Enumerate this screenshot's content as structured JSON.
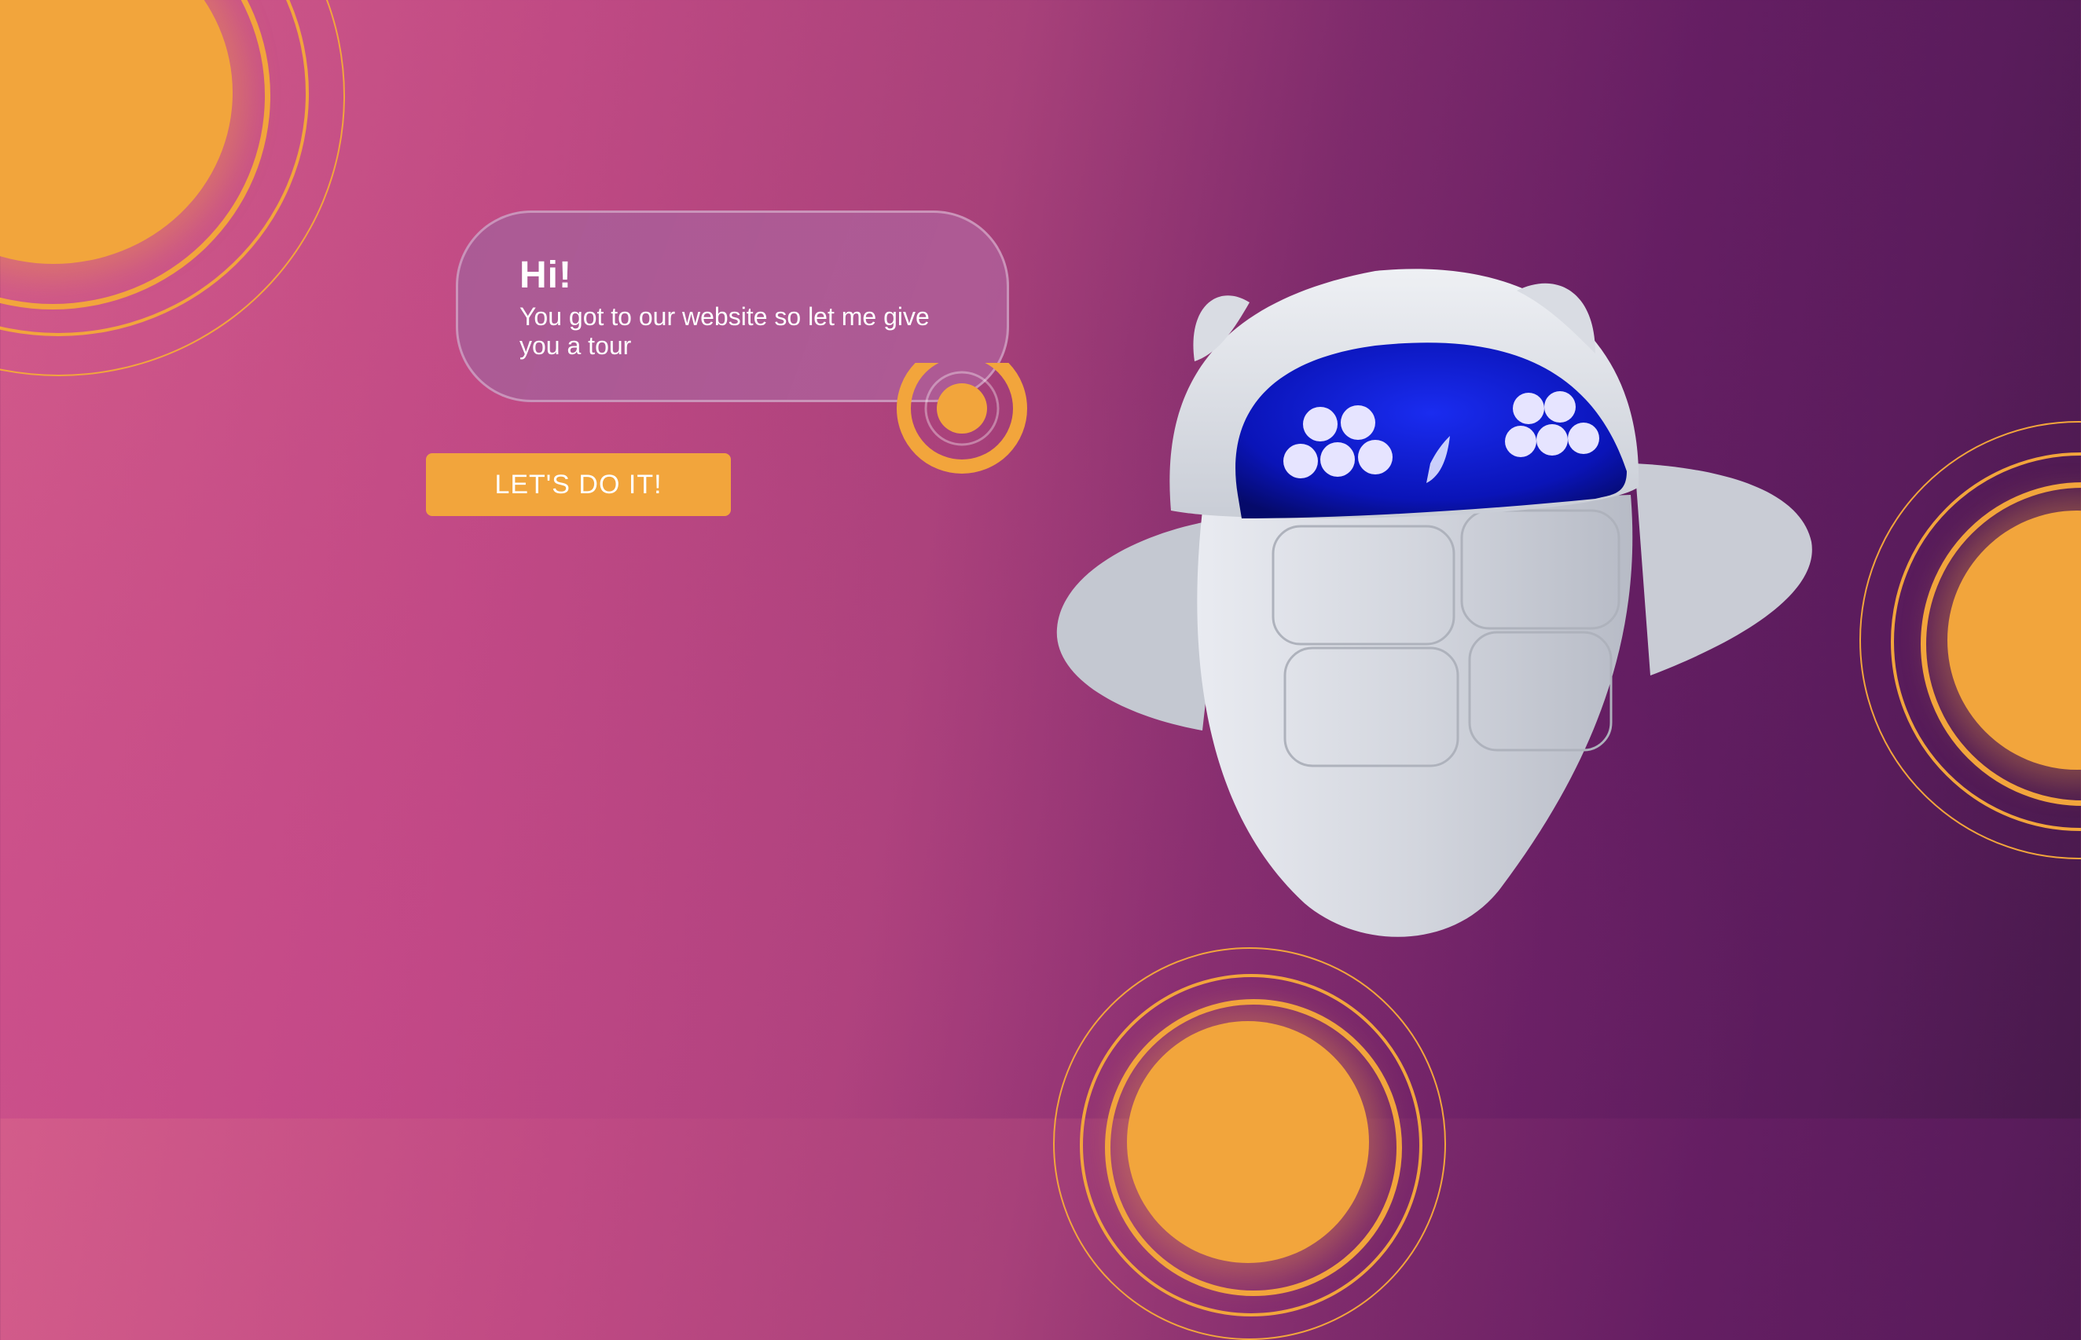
{
  "bubble": {
    "title": "Hi!",
    "message": "You got to our website so let me give you a tour"
  },
  "cta": {
    "label": "LET'S DO IT!"
  },
  "colors": {
    "accent": "#f2a53c",
    "bubble_bg": "#aa5c96",
    "robot_body": "#cfd3dc",
    "robot_visor": "#0a18c8"
  },
  "decor": {
    "suns": [
      "sun-top-left",
      "sun-right",
      "sun-bottom-center"
    ],
    "mascot": "robot-mascot"
  }
}
